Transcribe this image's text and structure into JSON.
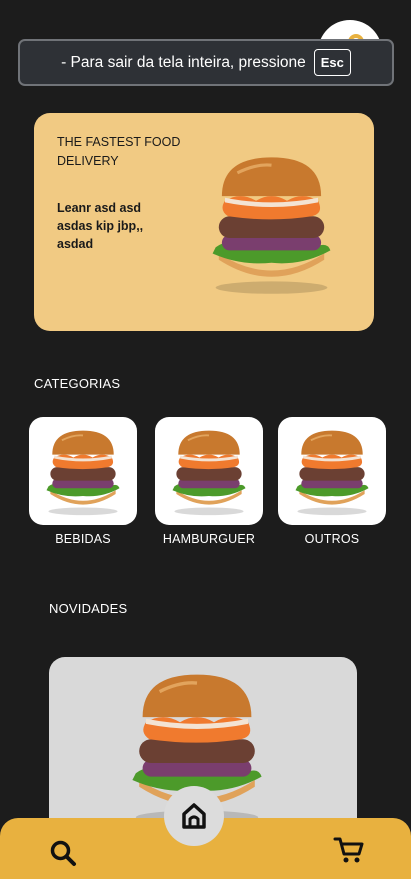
{
  "fullscreen_notice": {
    "text": "-  Para sair da tela inteira, pressione",
    "key": "Esc"
  },
  "hero": {
    "title": "THE FASTEST FOOD DELIVERY",
    "text": "Leanr asd asd asdas kip jbp,, asdad",
    "image_icon": "burger-image"
  },
  "categories": {
    "heading": "CATEGORIAS",
    "items": [
      {
        "label": "BEBIDAS",
        "icon": "burger-image"
      },
      {
        "label": "HAMBURGUER",
        "icon": "burger-image"
      },
      {
        "label": "OUTROS",
        "icon": "burger-image"
      }
    ]
  },
  "novidades": {
    "heading": "NOVIDADES"
  },
  "bottom_nav": {
    "icons": [
      "search-icon",
      "home-icon",
      "cart-icon"
    ],
    "colors": {
      "bar": "#e8b13f",
      "home_button": "#dcdcdc"
    }
  },
  "colors": {
    "background": "#1c1c1c",
    "hero": "#f1ca83",
    "card": "#ffffff",
    "novidade_card": "#d9d9d9"
  }
}
